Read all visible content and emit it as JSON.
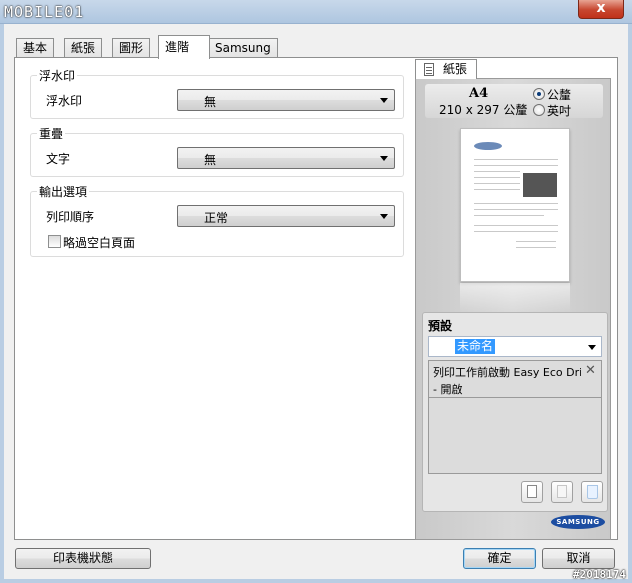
{
  "window": {
    "logo_text": "MOBILE01",
    "close_label": "x"
  },
  "tabs": [
    {
      "label": "基本"
    },
    {
      "label": "紙張"
    },
    {
      "label": "圖形"
    },
    {
      "label": "進階",
      "active": true
    },
    {
      "label": "Samsung"
    }
  ],
  "watermark_group": {
    "title": "浮水印",
    "field_label": "浮水印",
    "value": "無"
  },
  "overlay_group": {
    "title": "重疊",
    "field_label": "文字",
    "value": "無"
  },
  "output_group": {
    "title": "輸出選項",
    "field_label": "列印順序",
    "value": "正常",
    "skip_blank_label": "略過空白頁面",
    "skip_blank_checked": false
  },
  "preview": {
    "tab_label": "紙張",
    "size_name": "A4",
    "size_dim": "210 x 297 公釐",
    "unit_metric": "公釐",
    "unit_inch": "英吋",
    "selected_unit": "metric",
    "page_brand": "SAMSUNG"
  },
  "presets": {
    "title": "預設",
    "value": "未命名",
    "item_title": "列印工作前啟動 Easy Eco Dri...",
    "item_sub": "- 開啟",
    "brand": "SAMSUNG"
  },
  "footer": {
    "printer_status": "印表機狀態",
    "ok": "確定",
    "cancel": "取消",
    "watermark_text": "#2018174"
  },
  "colors": {
    "selection": "#3399ff",
    "brand_blue": "#1c4da1",
    "close_red": "#c7462f"
  }
}
